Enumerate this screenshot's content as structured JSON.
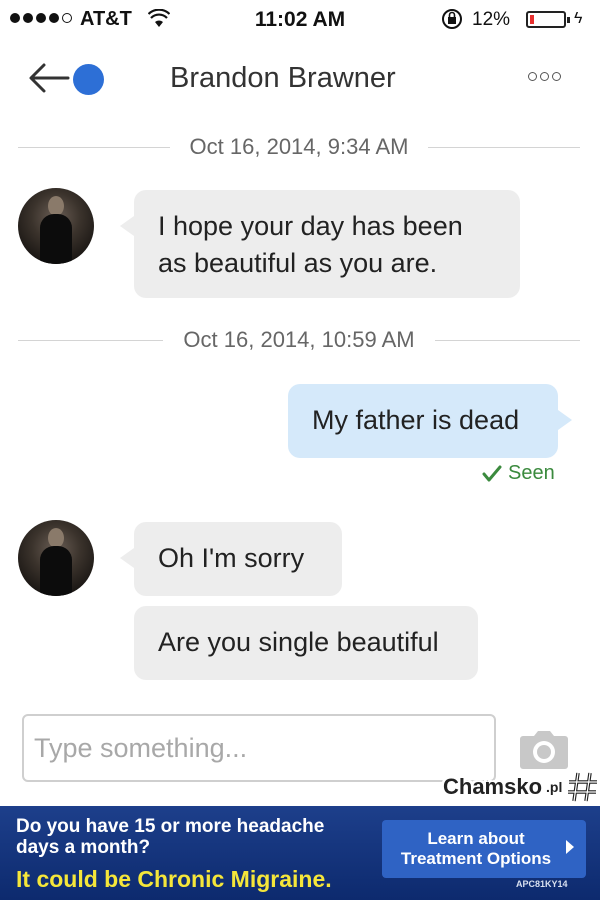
{
  "status_bar": {
    "carrier": "AT&T",
    "time": "11:02 AM",
    "battery_percent": "12%",
    "battery_level": 0.12,
    "battery_color": "#e8302f"
  },
  "header": {
    "contact_name": "Brandon Brawner",
    "back_icon": "back-arrow-icon",
    "menu_icon": "more-options-icon",
    "presence_color": "#2d6fd6"
  },
  "conversation": {
    "timestamp_1": "Oct 16, 2014, 9:34 AM",
    "message_1": "I hope your day has been as beautiful as you are.",
    "timestamp_2": "Oct 16, 2014, 10:59 AM",
    "message_2": "My father is dead",
    "seen_label": "Seen",
    "message_3": "Oh I'm sorry",
    "message_4": "Are you single beautiful"
  },
  "composer": {
    "placeholder": "Type something...",
    "camera_icon": "camera-icon"
  },
  "watermark": {
    "text": "Chamsko",
    "suffix": ".pl"
  },
  "ad": {
    "question": "Do you have 15 or more headache days a month?",
    "highlight": "It could be Chronic Migraine.",
    "cta": "Learn about Treatment Options",
    "code": "APC81KY14"
  },
  "colors": {
    "incoming_bubble": "#ededed",
    "outgoing_bubble": "#d5e9fa",
    "seen_check": "#3b8a3e",
    "ad_background": "#1d3f8b",
    "ad_highlight": "#f5e63a"
  }
}
